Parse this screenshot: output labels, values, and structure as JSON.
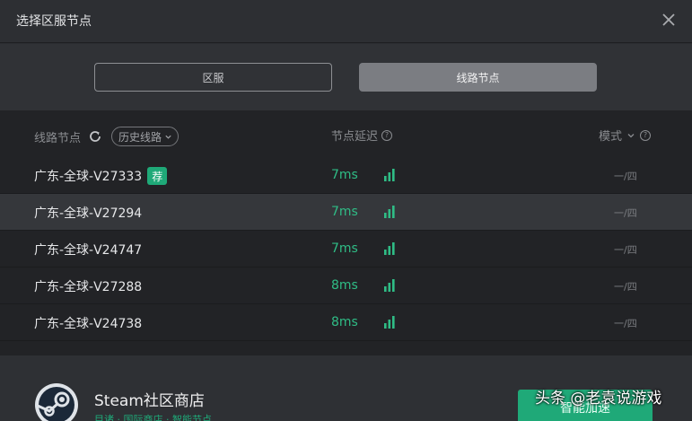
{
  "window": {
    "title": "选择区服节点"
  },
  "segments": {
    "left_label": "区服",
    "right_label": "线路节点",
    "selected": "right"
  },
  "list_header": {
    "col1": "线路节点",
    "history_label": "历史线路",
    "col2": "节点延迟",
    "col3": "模式"
  },
  "rows": [
    {
      "name": "广东-全球-V27333",
      "badge": "荐",
      "latency": "7ms",
      "mode": "一/四"
    },
    {
      "name": "广东-全球-V27294",
      "latency": "7ms",
      "mode": "一/四"
    },
    {
      "name": "广东-全球-V24747",
      "latency": "7ms",
      "mode": "一/四"
    },
    {
      "name": "广东-全球-V27288",
      "latency": "8ms",
      "mode": "一/四"
    },
    {
      "name": "广东-全球-V24738",
      "latency": "8ms",
      "mode": "一/四"
    }
  ],
  "footer": {
    "app_name": "Steam社区商店",
    "app_sub": "目诸 · 国际商店 · 智能节点",
    "start_label": "智能加速"
  },
  "watermark": "头条 @老袁说游戏",
  "colors": {
    "accent": "#1fa978",
    "latency": "#2fbd86",
    "background": "#2b2d31"
  },
  "icons": [
    "close-icon",
    "refresh-icon",
    "chevron-down-icon",
    "help-icon",
    "signal-icon",
    "steam-logo"
  ]
}
